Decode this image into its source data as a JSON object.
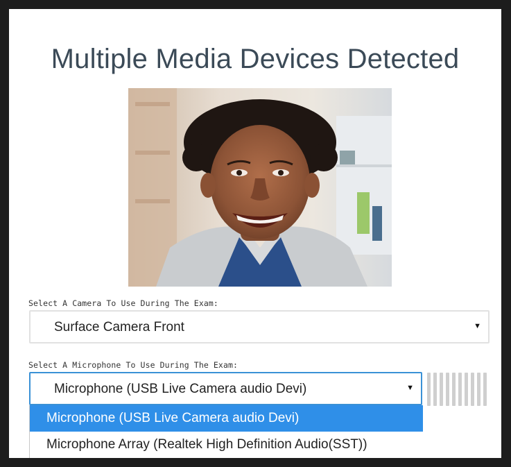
{
  "title": "Multiple Media Devices Detected",
  "camera": {
    "label": "Select A Camera To Use During The Exam:",
    "selected": "Surface Camera Front"
  },
  "microphone": {
    "label": "Select A Microphone To Use During The Exam:",
    "selected": "Microphone (USB Live Camera audio Devi)",
    "options": [
      "Microphone (USB Live Camera audio Devi)",
      "Microphone Array (Realtek High Definition Audio(SST))"
    ],
    "highlighted_index": 0
  },
  "colors": {
    "title": "#3b4a57",
    "focus_border": "#3a91d6",
    "highlight": "#2f8fe8"
  },
  "icons": {
    "caret": "caret-down-icon",
    "audio_meter": "audio-level-meter"
  }
}
